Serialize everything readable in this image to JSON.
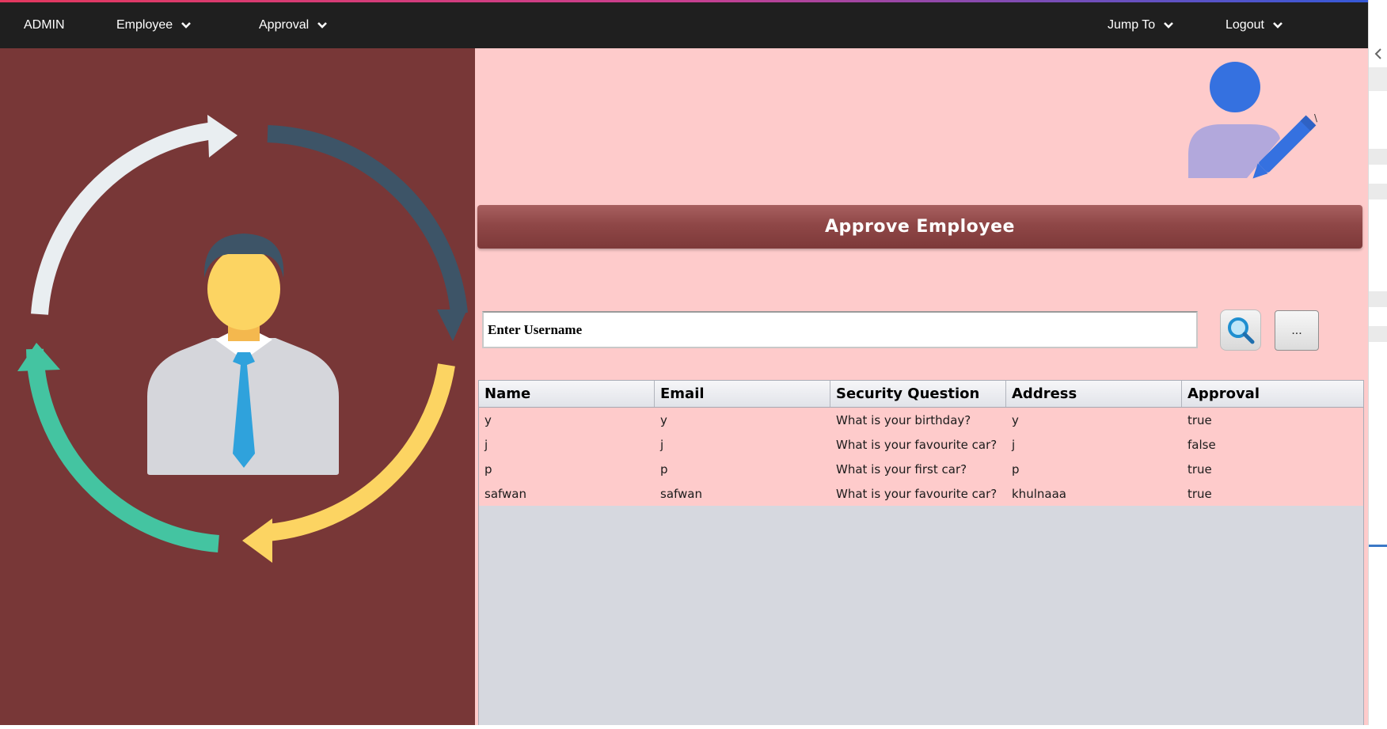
{
  "navbar": {
    "brand": "ADMIN",
    "employee_label": "Employee",
    "approval_label": "Approval",
    "jump_label": "Jump To",
    "logout_label": "Logout"
  },
  "page": {
    "title": "Approve Employee",
    "search_value": "Enter Username",
    "more_label": "..."
  },
  "table": {
    "headers": [
      "Name",
      "Email",
      "Security Question",
      "Address",
      "Approval"
    ],
    "rows": [
      [
        "y",
        "y",
        "What is your birthday?",
        "y",
        "true"
      ],
      [
        "j",
        "j",
        "What is your favourite car?",
        "j",
        "false"
      ],
      [
        "p",
        "p",
        "What is your first car?",
        "p",
        "true"
      ],
      [
        "safwan",
        "safwan",
        "What is your favourite car?",
        "khulnaaa",
        "true"
      ]
    ]
  },
  "icons": {
    "employee_dropdown": "chevron-down-icon",
    "approval_dropdown": "chevron-down-icon",
    "jump_dropdown": "chevron-down-icon",
    "logout_dropdown": "chevron-down-icon",
    "search": "search-icon",
    "user_edit": "user-edit-icon",
    "illustration": "employee-cycle-illustration",
    "scroll": "chevron-left-icon"
  },
  "colors": {
    "navbar": "#1f1f1f",
    "left_panel": "#783737",
    "right_panel": "#fecbcb",
    "title_bar": "#8f4747",
    "table_empty": "#d6d8df",
    "accent_blue": "#3571e0"
  }
}
